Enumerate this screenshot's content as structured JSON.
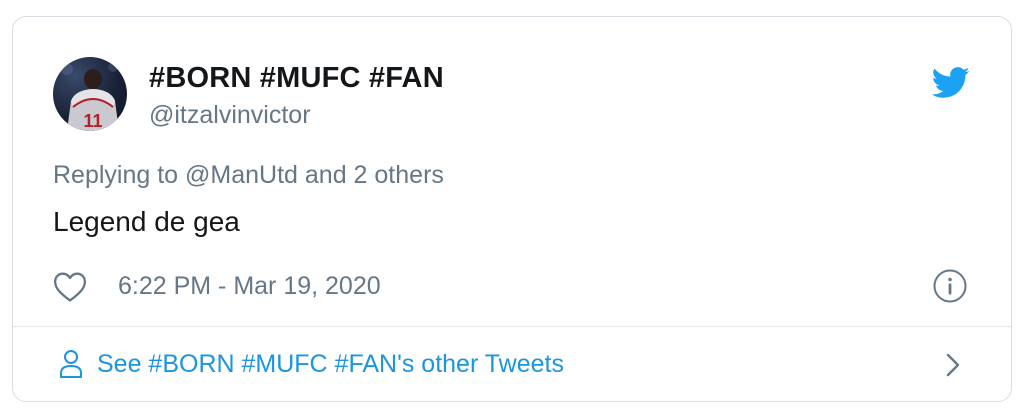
{
  "tweet": {
    "author": {
      "display_name": "#BORN #MUFC #FAN",
      "handle": "@itzalvinvictor",
      "avatar_jersey_number": "11"
    },
    "replying": {
      "prefix": "Replying to ",
      "target": "@ManUtd",
      "suffix": " and 2 others"
    },
    "text": "Legend de gea",
    "timestamp": "6:22 PM - Mar 19, 2020"
  },
  "footer": {
    "label": "See #BORN #MUFC #FAN's other Tweets"
  },
  "icons": {
    "logo": "twitter-bird-icon",
    "like": "heart-icon",
    "info": "info-icon",
    "profile": "person-icon",
    "next": "chevron-right-icon"
  },
  "colors": {
    "twitter_blue": "#1da1f2",
    "link_blue": "#1b95e0",
    "secondary_text": "#657786",
    "primary_text": "#14171a",
    "border": "#d9dfe4"
  }
}
